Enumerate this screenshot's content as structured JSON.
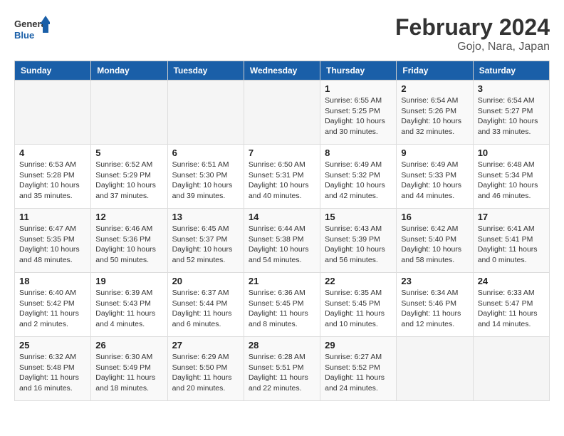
{
  "logo": {
    "text1": "General",
    "text2": "Blue"
  },
  "title": "February 2024",
  "subtitle": "Gojo, Nara, Japan",
  "days_header": [
    "Sunday",
    "Monday",
    "Tuesday",
    "Wednesday",
    "Thursday",
    "Friday",
    "Saturday"
  ],
  "weeks": [
    [
      {
        "day": "",
        "info": ""
      },
      {
        "day": "",
        "info": ""
      },
      {
        "day": "",
        "info": ""
      },
      {
        "day": "",
        "info": ""
      },
      {
        "day": "1",
        "info": "Sunrise: 6:55 AM\nSunset: 5:25 PM\nDaylight: 10 hours and 30 minutes."
      },
      {
        "day": "2",
        "info": "Sunrise: 6:54 AM\nSunset: 5:26 PM\nDaylight: 10 hours and 32 minutes."
      },
      {
        "day": "3",
        "info": "Sunrise: 6:54 AM\nSunset: 5:27 PM\nDaylight: 10 hours and 33 minutes."
      }
    ],
    [
      {
        "day": "4",
        "info": "Sunrise: 6:53 AM\nSunset: 5:28 PM\nDaylight: 10 hours and 35 minutes."
      },
      {
        "day": "5",
        "info": "Sunrise: 6:52 AM\nSunset: 5:29 PM\nDaylight: 10 hours and 37 minutes."
      },
      {
        "day": "6",
        "info": "Sunrise: 6:51 AM\nSunset: 5:30 PM\nDaylight: 10 hours and 39 minutes."
      },
      {
        "day": "7",
        "info": "Sunrise: 6:50 AM\nSunset: 5:31 PM\nDaylight: 10 hours and 40 minutes."
      },
      {
        "day": "8",
        "info": "Sunrise: 6:49 AM\nSunset: 5:32 PM\nDaylight: 10 hours and 42 minutes."
      },
      {
        "day": "9",
        "info": "Sunrise: 6:49 AM\nSunset: 5:33 PM\nDaylight: 10 hours and 44 minutes."
      },
      {
        "day": "10",
        "info": "Sunrise: 6:48 AM\nSunset: 5:34 PM\nDaylight: 10 hours and 46 minutes."
      }
    ],
    [
      {
        "day": "11",
        "info": "Sunrise: 6:47 AM\nSunset: 5:35 PM\nDaylight: 10 hours and 48 minutes."
      },
      {
        "day": "12",
        "info": "Sunrise: 6:46 AM\nSunset: 5:36 PM\nDaylight: 10 hours and 50 minutes."
      },
      {
        "day": "13",
        "info": "Sunrise: 6:45 AM\nSunset: 5:37 PM\nDaylight: 10 hours and 52 minutes."
      },
      {
        "day": "14",
        "info": "Sunrise: 6:44 AM\nSunset: 5:38 PM\nDaylight: 10 hours and 54 minutes."
      },
      {
        "day": "15",
        "info": "Sunrise: 6:43 AM\nSunset: 5:39 PM\nDaylight: 10 hours and 56 minutes."
      },
      {
        "day": "16",
        "info": "Sunrise: 6:42 AM\nSunset: 5:40 PM\nDaylight: 10 hours and 58 minutes."
      },
      {
        "day": "17",
        "info": "Sunrise: 6:41 AM\nSunset: 5:41 PM\nDaylight: 11 hours and 0 minutes."
      }
    ],
    [
      {
        "day": "18",
        "info": "Sunrise: 6:40 AM\nSunset: 5:42 PM\nDaylight: 11 hours and 2 minutes."
      },
      {
        "day": "19",
        "info": "Sunrise: 6:39 AM\nSunset: 5:43 PM\nDaylight: 11 hours and 4 minutes."
      },
      {
        "day": "20",
        "info": "Sunrise: 6:37 AM\nSunset: 5:44 PM\nDaylight: 11 hours and 6 minutes."
      },
      {
        "day": "21",
        "info": "Sunrise: 6:36 AM\nSunset: 5:45 PM\nDaylight: 11 hours and 8 minutes."
      },
      {
        "day": "22",
        "info": "Sunrise: 6:35 AM\nSunset: 5:45 PM\nDaylight: 11 hours and 10 minutes."
      },
      {
        "day": "23",
        "info": "Sunrise: 6:34 AM\nSunset: 5:46 PM\nDaylight: 11 hours and 12 minutes."
      },
      {
        "day": "24",
        "info": "Sunrise: 6:33 AM\nSunset: 5:47 PM\nDaylight: 11 hours and 14 minutes."
      }
    ],
    [
      {
        "day": "25",
        "info": "Sunrise: 6:32 AM\nSunset: 5:48 PM\nDaylight: 11 hours and 16 minutes."
      },
      {
        "day": "26",
        "info": "Sunrise: 6:30 AM\nSunset: 5:49 PM\nDaylight: 11 hours and 18 minutes."
      },
      {
        "day": "27",
        "info": "Sunrise: 6:29 AM\nSunset: 5:50 PM\nDaylight: 11 hours and 20 minutes."
      },
      {
        "day": "28",
        "info": "Sunrise: 6:28 AM\nSunset: 5:51 PM\nDaylight: 11 hours and 22 minutes."
      },
      {
        "day": "29",
        "info": "Sunrise: 6:27 AM\nSunset: 5:52 PM\nDaylight: 11 hours and 24 minutes."
      },
      {
        "day": "",
        "info": ""
      },
      {
        "day": "",
        "info": ""
      }
    ]
  ]
}
